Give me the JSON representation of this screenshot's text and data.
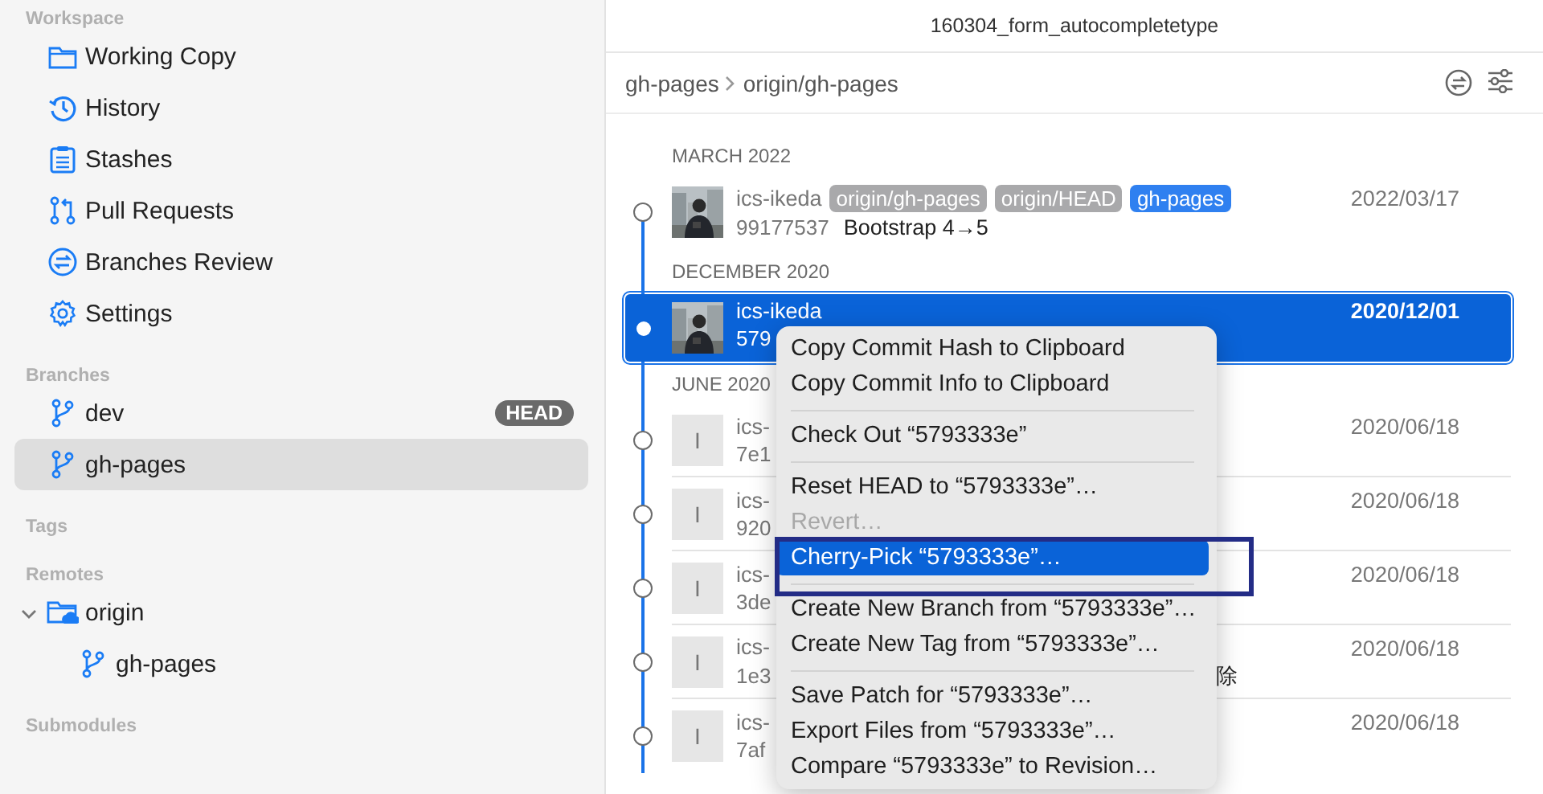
{
  "window": {
    "title": "160304_form_autocompletetype"
  },
  "sidebar": {
    "sections": [
      {
        "title": "Workspace",
        "items": [
          {
            "label": "Working Copy",
            "selected": false
          },
          {
            "label": "History",
            "selected": false
          },
          {
            "label": "Stashes",
            "selected": false
          },
          {
            "label": "Pull Requests",
            "selected": false
          },
          {
            "label": "Branches Review",
            "selected": false
          },
          {
            "label": "Settings",
            "selected": false
          }
        ]
      },
      {
        "title": "Branches",
        "items": [
          {
            "label": "dev",
            "badge": "HEAD",
            "selected": false
          },
          {
            "label": "gh-pages",
            "selected": true
          }
        ]
      },
      {
        "title": "Tags"
      },
      {
        "title": "Remotes",
        "items": [
          {
            "label": "origin",
            "selected": false,
            "expanded": true,
            "children": [
              {
                "label": "gh-pages",
                "selected": false
              }
            ]
          }
        ]
      },
      {
        "title": "Submodules"
      }
    ]
  },
  "breadcrumb": [
    "gh-pages",
    "origin/gh-pages"
  ],
  "history": [
    {
      "heading": "MARCH 2022",
      "commits": [
        {
          "author": "ics-ikeda",
          "refs": [
            {
              "label": "origin/gh-pages",
              "color": "#a9a9ab"
            },
            {
              "label": "origin/HEAD",
              "color": "#a9a9ab"
            },
            {
              "label": "gh-pages",
              "color": "#2f80f0"
            }
          ],
          "hash": "99177537",
          "message": "Bootstrap 4→5",
          "date": "2022/03/17",
          "selected": false
        }
      ]
    },
    {
      "heading": "DECEMBER 2020",
      "commits": [
        {
          "author": "ics-ikeda",
          "hash": "579",
          "date": "2020/12/01",
          "selected": true
        }
      ]
    },
    {
      "heading": "JUNE 2020",
      "commits": [
        {
          "kind": "initial",
          "initial": "I",
          "author": "ics-",
          "hash": "7e1",
          "date": "2020/06/18",
          "selected": false
        },
        {
          "kind": "initial",
          "initial": "I",
          "author": "ics-",
          "hash": "920",
          "date": "2020/06/18",
          "selected": false
        },
        {
          "kind": "initial",
          "initial": "I",
          "author": "ics-",
          "hash": "3de",
          "date": "2020/06/18",
          "selected": false
        },
        {
          "kind": "initial",
          "initial": "I",
          "author": "ics-",
          "hash": "1e3",
          "message": "除",
          "date": "2020/06/18",
          "selected": false
        },
        {
          "kind": "initial",
          "initial": "I",
          "author": "ics-",
          "hash": "7af",
          "date": "2020/06/18",
          "selected": false
        }
      ]
    }
  ],
  "context_menu": [
    {
      "kind": "item",
      "label": "Copy Commit Hash to Clipboard",
      "disabled": false,
      "selected": false
    },
    {
      "kind": "item",
      "label": "Copy Commit Info to Clipboard",
      "disabled": false,
      "selected": false
    },
    {
      "kind": "separator"
    },
    {
      "kind": "item",
      "label": "Check Out “5793333e”",
      "disabled": false,
      "selected": false
    },
    {
      "kind": "separator"
    },
    {
      "kind": "item",
      "label": "Reset HEAD to “5793333e”…",
      "disabled": false,
      "selected": false
    },
    {
      "kind": "item",
      "label": "Revert…",
      "disabled": true,
      "selected": false
    },
    {
      "kind": "item",
      "label": "Cherry-Pick “5793333e”…",
      "disabled": false,
      "selected": true
    },
    {
      "kind": "separator"
    },
    {
      "kind": "item",
      "label": "Create New Branch from “5793333e”…",
      "disabled": false,
      "selected": false
    },
    {
      "kind": "item",
      "label": "Create New Tag from “5793333e”…",
      "disabled": false,
      "selected": false
    },
    {
      "kind": "separator"
    },
    {
      "kind": "item",
      "label": "Save Patch for “5793333e”…",
      "disabled": false,
      "selected": false
    },
    {
      "kind": "item",
      "label": "Export Files from “5793333e”…",
      "disabled": false,
      "selected": false
    },
    {
      "kind": "item",
      "label": "Compare “5793333e” to Revision…",
      "disabled": false,
      "selected": false
    }
  ],
  "annotation": {
    "kind": "frame"
  }
}
